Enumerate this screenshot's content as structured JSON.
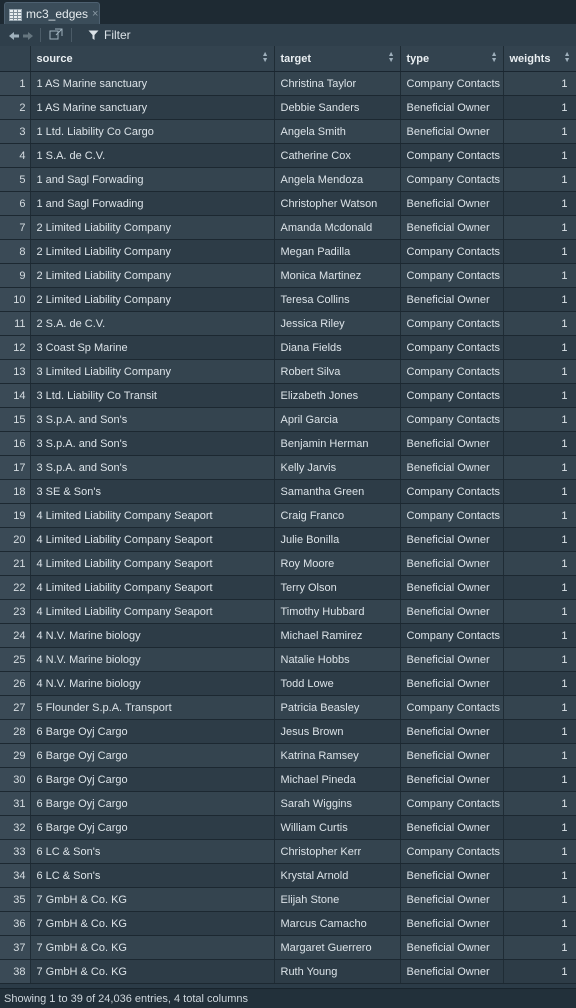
{
  "tab": {
    "label": "mc3_edges",
    "close": "×"
  },
  "toolbar": {
    "filter_label": "Filter"
  },
  "columns": [
    "source",
    "target",
    "type",
    "weights"
  ],
  "rows": [
    [
      "1",
      "1 AS Marine sanctuary",
      "Christina Taylor",
      "Company Contacts",
      "1"
    ],
    [
      "2",
      "1 AS Marine sanctuary",
      "Debbie Sanders",
      "Beneficial Owner",
      "1"
    ],
    [
      "3",
      "1 Ltd. Liability Co Cargo",
      "Angela Smith",
      "Beneficial Owner",
      "1"
    ],
    [
      "4",
      "1 S.A. de C.V.",
      "Catherine Cox",
      "Company Contacts",
      "1"
    ],
    [
      "5",
      "1 and Sagl Forwading",
      "Angela Mendoza",
      "Company Contacts",
      "1"
    ],
    [
      "6",
      "1 and Sagl Forwading",
      "Christopher Watson",
      "Beneficial Owner",
      "1"
    ],
    [
      "7",
      "2 Limited Liability Company",
      "Amanda Mcdonald",
      "Beneficial Owner",
      "1"
    ],
    [
      "8",
      "2 Limited Liability Company",
      "Megan Padilla",
      "Company Contacts",
      "1"
    ],
    [
      "9",
      "2 Limited Liability Company",
      "Monica Martinez",
      "Company Contacts",
      "1"
    ],
    [
      "10",
      "2 Limited Liability Company",
      "Teresa Collins",
      "Beneficial Owner",
      "1"
    ],
    [
      "11",
      "2 S.A. de C.V.",
      "Jessica Riley",
      "Company Contacts",
      "1"
    ],
    [
      "12",
      "3 Coast Sp Marine",
      "Diana Fields",
      "Company Contacts",
      "1"
    ],
    [
      "13",
      "3 Limited Liability Company",
      "Robert Silva",
      "Company Contacts",
      "1"
    ],
    [
      "14",
      "3 Ltd. Liability Co Transit",
      "Elizabeth Jones",
      "Company Contacts",
      "1"
    ],
    [
      "15",
      "3 S.p.A. and Son's",
      "April Garcia",
      "Company Contacts",
      "1"
    ],
    [
      "16",
      "3 S.p.A. and Son's",
      "Benjamin Herman",
      "Beneficial Owner",
      "1"
    ],
    [
      "17",
      "3 S.p.A. and Son's",
      "Kelly Jarvis",
      "Beneficial Owner",
      "1"
    ],
    [
      "18",
      "3 SE & Son's",
      "Samantha Green",
      "Company Contacts",
      "1"
    ],
    [
      "19",
      "4 Limited Liability Company Seaport",
      "Craig Franco",
      "Company Contacts",
      "1"
    ],
    [
      "20",
      "4 Limited Liability Company Seaport",
      "Julie Bonilla",
      "Beneficial Owner",
      "1"
    ],
    [
      "21",
      "4 Limited Liability Company Seaport",
      "Roy Moore",
      "Beneficial Owner",
      "1"
    ],
    [
      "22",
      "4 Limited Liability Company Seaport",
      "Terry Olson",
      "Beneficial Owner",
      "1"
    ],
    [
      "23",
      "4 Limited Liability Company Seaport",
      "Timothy Hubbard",
      "Beneficial Owner",
      "1"
    ],
    [
      "24",
      "4 N.V. Marine biology",
      "Michael Ramirez",
      "Company Contacts",
      "1"
    ],
    [
      "25",
      "4 N.V. Marine biology",
      "Natalie Hobbs",
      "Beneficial Owner",
      "1"
    ],
    [
      "26",
      "4 N.V. Marine biology",
      "Todd Lowe",
      "Beneficial Owner",
      "1"
    ],
    [
      "27",
      "5 Flounder S.p.A. Transport",
      "Patricia Beasley",
      "Company Contacts",
      "1"
    ],
    [
      "28",
      "6 Barge Oyj Cargo",
      "Jesus Brown",
      "Beneficial Owner",
      "1"
    ],
    [
      "29",
      "6 Barge Oyj Cargo",
      "Katrina Ramsey",
      "Beneficial Owner",
      "1"
    ],
    [
      "30",
      "6 Barge Oyj Cargo",
      "Michael Pineda",
      "Beneficial Owner",
      "1"
    ],
    [
      "31",
      "6 Barge Oyj Cargo",
      "Sarah Wiggins",
      "Company Contacts",
      "1"
    ],
    [
      "32",
      "6 Barge Oyj Cargo",
      "William Curtis",
      "Beneficial Owner",
      "1"
    ],
    [
      "33",
      "6 LC & Son's",
      "Christopher Kerr",
      "Company Contacts",
      "1"
    ],
    [
      "34",
      "6 LC & Son's",
      "Krystal Arnold",
      "Beneficial Owner",
      "1"
    ],
    [
      "35",
      "7 GmbH & Co. KG",
      "Elijah Stone",
      "Beneficial Owner",
      "1"
    ],
    [
      "36",
      "7 GmbH & Co. KG",
      "Marcus Camacho",
      "Beneficial Owner",
      "1"
    ],
    [
      "37",
      "7 GmbH & Co. KG",
      "Margaret Guerrero",
      "Beneficial Owner",
      "1"
    ],
    [
      "38",
      "7 GmbH & Co. KG",
      "Ruth Young",
      "Beneficial Owner",
      "1"
    ]
  ],
  "status": {
    "text": "Showing 1 to 39 of 24,036 entries, 4 total columns"
  },
  "colors": {
    "background": "#2b3b47",
    "header": "#33434f",
    "row_odd": "#34444f",
    "row_even": "#2d3c47"
  },
  "icons": [
    "table-grid-icon",
    "close-icon",
    "back-arrow-icon",
    "forward-arrow-icon",
    "popout-icon",
    "filter-icon",
    "sort-icon"
  ]
}
